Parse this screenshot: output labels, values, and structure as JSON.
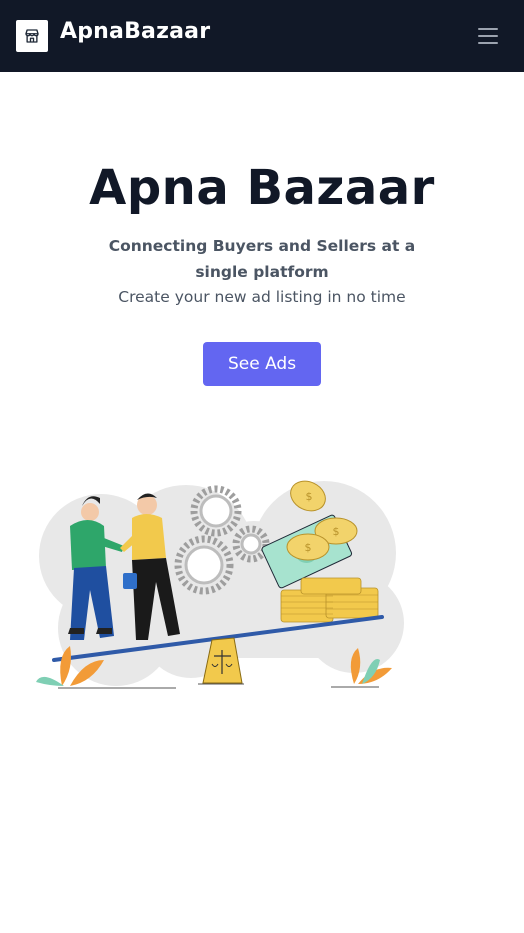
{
  "navbar": {
    "brand_name": "ApnaBazaar",
    "logo_icon": "storefront-icon",
    "menu_icon": "hamburger-menu-icon",
    "background": "#111827"
  },
  "hero": {
    "title": "Apna Bazaar",
    "subtitle": "Connecting Buyers and Sellers at a single platform",
    "text": "Create your new ad listing in no time",
    "cta_label": "See Ads",
    "accent_color": "#6366f1"
  },
  "illustration": {
    "icon": "handshake-deal-illustration"
  }
}
